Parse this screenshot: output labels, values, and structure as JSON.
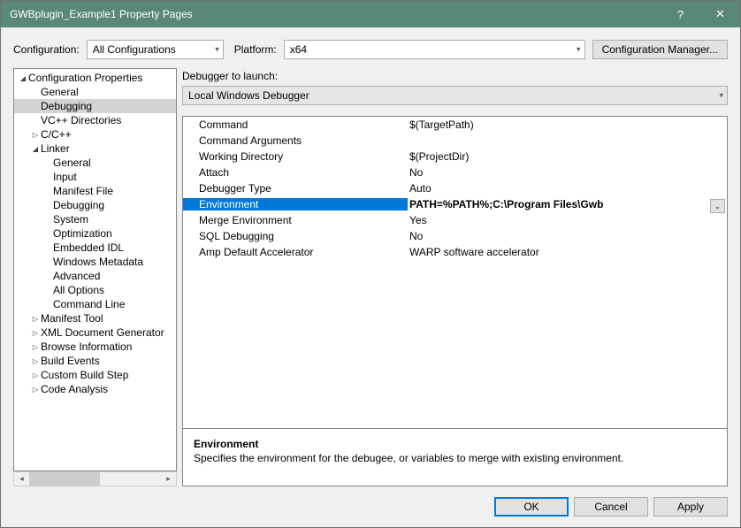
{
  "title": "GWBplugin_Example1 Property Pages",
  "top": {
    "configLabel": "Configuration:",
    "configValue": "All Configurations",
    "platformLabel": "Platform:",
    "platformValue": "x64",
    "cfgMgr": "Configuration Manager..."
  },
  "tree": {
    "root": "Configuration Properties",
    "l1": [
      "General",
      "Debugging",
      "VC++ Directories"
    ],
    "ccpp": "C/C++",
    "linker": "Linker",
    "linkerItems": [
      "General",
      "Input",
      "Manifest File",
      "Debugging",
      "System",
      "Optimization",
      "Embedded IDL",
      "Windows Metadata",
      "Advanced",
      "All Options",
      "Command Line"
    ],
    "tail": [
      "Manifest Tool",
      "XML Document Generator",
      "Browse Information",
      "Build Events",
      "Custom Build Step",
      "Code Analysis"
    ]
  },
  "debuggerToLaunchLabel": "Debugger to launch:",
  "debuggerToLaunchValue": "Local Windows Debugger",
  "grid": [
    {
      "k": "Command",
      "v": "$(TargetPath)"
    },
    {
      "k": "Command Arguments",
      "v": ""
    },
    {
      "k": "Working Directory",
      "v": "$(ProjectDir)"
    },
    {
      "k": "Attach",
      "v": "No"
    },
    {
      "k": "Debugger Type",
      "v": "Auto"
    },
    {
      "k": "Environment",
      "v": "PATH=%PATH%;C:\\Program Files\\Gwb",
      "sel": true
    },
    {
      "k": "Merge Environment",
      "v": "Yes"
    },
    {
      "k": "SQL Debugging",
      "v": "No"
    },
    {
      "k": "Amp Default Accelerator",
      "v": "WARP software accelerator"
    }
  ],
  "desc": {
    "title": "Environment",
    "text": "Specifies the environment for the debugee, or variables to merge with existing environment."
  },
  "buttons": {
    "ok": "OK",
    "cancel": "Cancel",
    "apply": "Apply"
  }
}
